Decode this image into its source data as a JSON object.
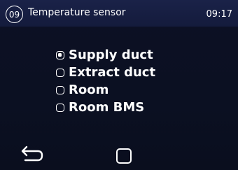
{
  "header": {
    "step": "09",
    "title": "Temperature sensor",
    "time": "09:17"
  },
  "options": [
    {
      "label": "Supply duct",
      "selected": true
    },
    {
      "label": "Extract duct",
      "selected": false
    },
    {
      "label": "Room",
      "selected": false
    },
    {
      "label": "Room BMS",
      "selected": false
    }
  ],
  "footer": {
    "back_icon": "back-arrow-icon",
    "home_icon": "home-square-icon"
  },
  "colors": {
    "background": "#0b0f20",
    "header": "#171f44",
    "foreground": "#ffffff"
  }
}
